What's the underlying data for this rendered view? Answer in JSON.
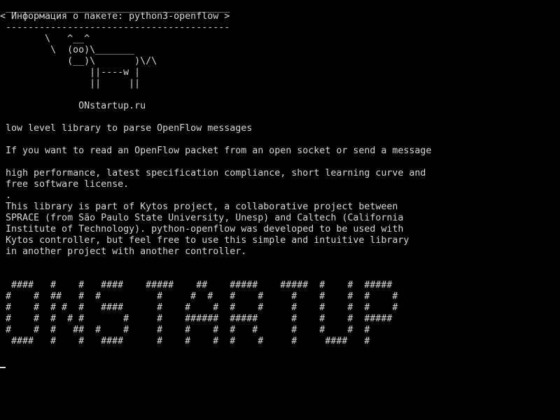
{
  "screen": {
    "foreground_color": "#d8d8d8",
    "background_color": "#000000"
  },
  "lines": [
    {
      "text": " ________________________________________",
      "row": 0
    },
    {
      "text": "< Информация о пакете: python3-openflow >",
      "row": 1
    },
    {
      "text": " ----------------------------------------",
      "row": 2
    },
    {
      "text": "        \\   ^__^",
      "row": 3
    },
    {
      "text": "         \\  (oo)\\_______",
      "row": 4
    },
    {
      "text": "            (__)\\       )\\/\\",
      "row": 5
    },
    {
      "text": "                ||----w |",
      "row": 6
    },
    {
      "text": "                ||     ||",
      "row": 7
    },
    {
      "text": "",
      "row": 8
    },
    {
      "text": "              ONstartup.ru",
      "row": 9
    },
    {
      "text": "",
      "row": 10
    },
    {
      "text": " low level library to parse OpenFlow messages",
      "row": 11
    },
    {
      "text": "",
      "row": 12
    },
    {
      "text": " If you want to read an OpenFlow packet from an open socket or send a message",
      "row": 13
    },
    {
      "text": "",
      "row": 14
    },
    {
      "text": " high performance, latest specification compliance, short learning curve and",
      "row": 15
    },
    {
      "text": " free software license.",
      "row": 16
    },
    {
      "text": " .",
      "row": 17
    },
    {
      "text": " This library is part of Kytos project, a collaborative project between",
      "row": 18
    },
    {
      "text": " SPRACE (from São Paulo State University, Unesp) and Caltech (California",
      "row": 19
    },
    {
      "text": " Institute of Technology). python-openflow was developed to be used with",
      "row": 20
    },
    {
      "text": " Kytos controller, but feel free to use this simple and intuitive library",
      "row": 21
    },
    {
      "text": " in another project with another controller.",
      "row": 22
    },
    {
      "text": "",
      "row": 23
    },
    {
      "text": "",
      "row": 24
    },
    {
      "text": "  ####   #    #   ####    #####    ##    #####    #####  #    #  #####",
      "row": 25
    },
    {
      "text": " #    #  ##   #  #          #     #  #   #    #     #    #    #  #    #",
      "row": 26
    },
    {
      "text": " #    #  # #  #   ####      #    #    #  #    #     #    #    #  #    #",
      "row": 27
    },
    {
      "text": " #    #  #  # #       #     #    ######  #####      #    #    #  #####",
      "row": 28
    },
    {
      "text": " #    #  #   ##  #    #     #    #    #  #   #      #    #    #  #",
      "row": 29
    },
    {
      "text": "  ####   #    #   ####      #    #    #  #    #     #     ####   #",
      "row": 30
    }
  ]
}
